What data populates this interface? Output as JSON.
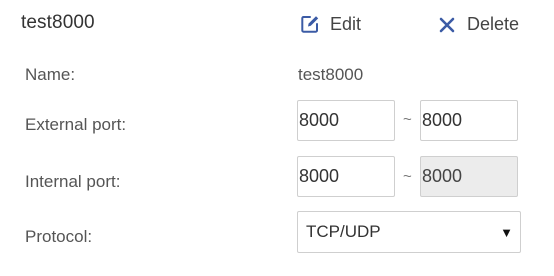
{
  "rule": {
    "name": "test8000",
    "edit_label": "Edit",
    "delete_label": "Delete"
  },
  "fields": {
    "name_label": "Name:",
    "name_value": "test8000",
    "external_port_label": "External port:",
    "external_port_start": "8000",
    "external_port_end": "8000",
    "internal_port_label": "Internal port:",
    "internal_port_start": "8000",
    "internal_port_end": "8000",
    "range_separator": "~",
    "protocol_label": "Protocol:",
    "protocol_value": "TCP/UDP"
  },
  "icons": {
    "edit": "edit-icon",
    "delete": "close-icon",
    "dropdown": "caret-down-icon"
  },
  "colors": {
    "accent": "#3b5ba5",
    "disabled_bg": "#ececec"
  }
}
